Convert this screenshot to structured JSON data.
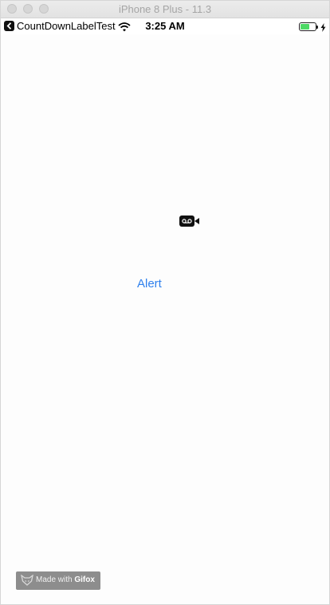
{
  "window": {
    "title": "iPhone 8 Plus - 11.3"
  },
  "statusbar": {
    "back_app": "CountDownLabelTest",
    "time": "3:25 AM",
    "battery_level": 0.6,
    "icons": [
      "back-icon",
      "wifi-icon",
      "battery-icon",
      "charging-bolt-icon"
    ]
  },
  "main": {
    "alert_button_label": "Alert",
    "record_icon": "screen-record-icon",
    "accent_color": "#2f80ed"
  },
  "watermark": {
    "prefix": "Made with ",
    "brand": "Gifox"
  }
}
